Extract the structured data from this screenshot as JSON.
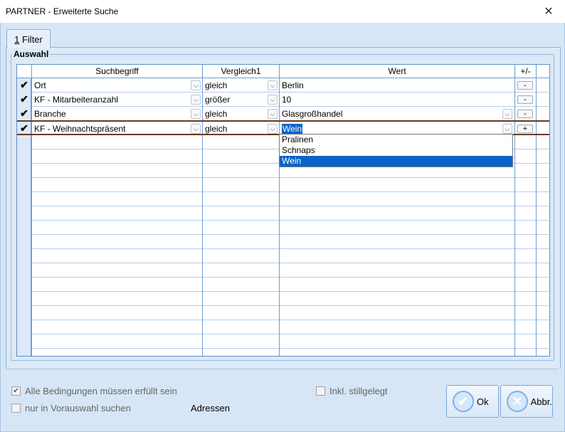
{
  "window": {
    "title": "PARTNER - Erweiterte Suche",
    "close_glyph": "✕"
  },
  "tabs": [
    {
      "prefix": "1",
      "label": " Filter"
    }
  ],
  "group": {
    "label": "Auswahl"
  },
  "grid": {
    "headers": {
      "suchbegriff": "Suchbegriff",
      "vergleich": "Vergleich1",
      "wert": "Wert",
      "plusminus": "+/-"
    },
    "rows": [
      {
        "check": "✔",
        "suchbegriff": "Ort",
        "vergleich": "gleich",
        "wert": "Berlin",
        "btn": "-"
      },
      {
        "check": "✔",
        "suchbegriff": "KF - Mitarbeiteranzahl",
        "vergleich": "größer",
        "wert": "10",
        "btn": "-"
      },
      {
        "check": "✔",
        "suchbegriff": "Branche",
        "vergleich": "gleich",
        "wert": "Glasgroßhandel",
        "btn": "-"
      },
      {
        "check": "✔",
        "suchbegriff": "KF - Weihnachtspräsent",
        "vergleich": "gleich",
        "wert": "Wein",
        "btn": "+"
      }
    ],
    "dropdown_options": [
      "Pralinen",
      "Schnaps",
      "Wein"
    ],
    "dropdown_selected": "Wein"
  },
  "bottom": {
    "alle_bedingungen": "Alle Bedingungen müssen erfüllt sein",
    "alle_bedingungen_checked": "✔",
    "nur_vorauswahl": "nur in Vorauswahl suchen",
    "inkl_stillgelegt": "Inkl. stillgelegt",
    "adressen": "Adressen",
    "ok_label": "Ok",
    "abbr_label": "Abbr."
  },
  "icons": {
    "dropdown": "chevron-down-icon",
    "ok": "checkmark-icon",
    "cancel": "x-icon"
  },
  "colors": {
    "selection": "#0a64c8",
    "grid_line": "#6e9bd1",
    "background": "#d7e6f6"
  }
}
